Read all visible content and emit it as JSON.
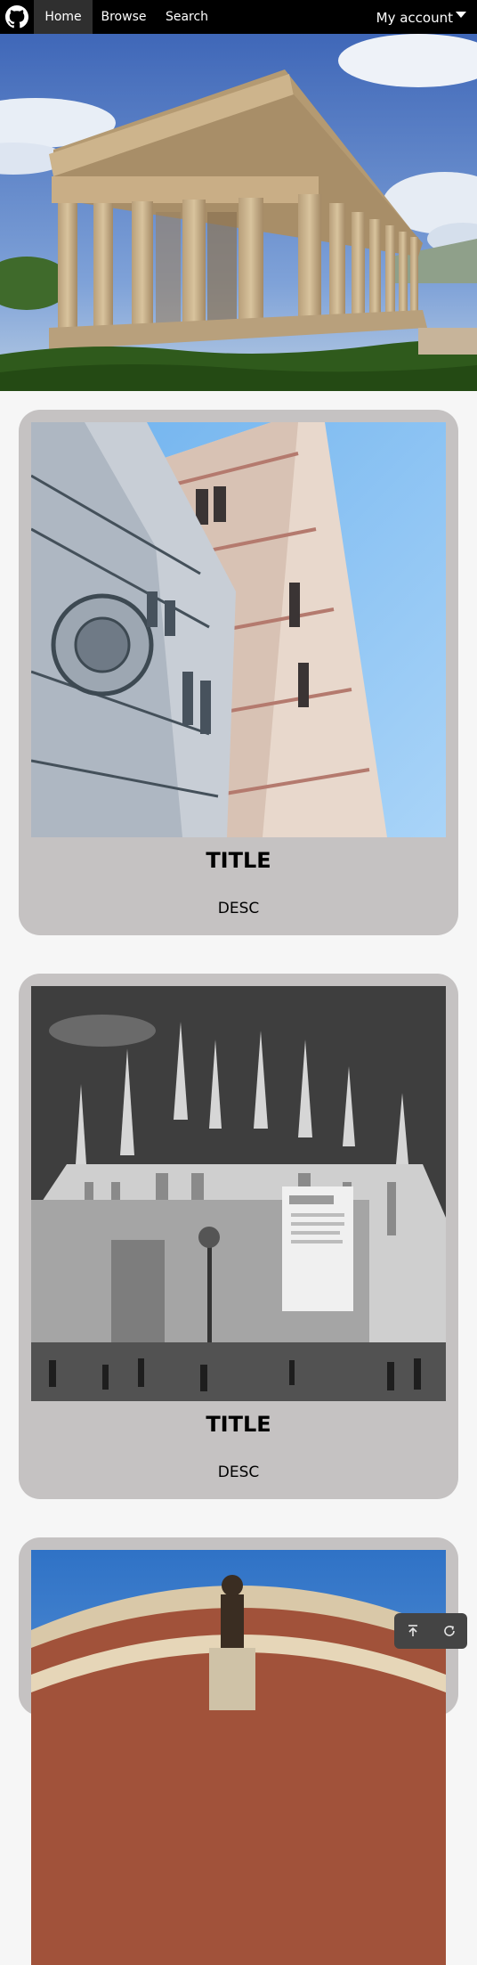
{
  "navbar": {
    "logo_icon": "github-icon",
    "items": [
      {
        "label": "Home",
        "active": true
      },
      {
        "label": "Browse",
        "active": false
      },
      {
        "label": "Search",
        "active": false
      }
    ],
    "account_label": "My account"
  },
  "hero": {
    "image": "greek-temple-photo"
  },
  "cards": [
    {
      "title": "TITLE",
      "desc": "DESC",
      "image": "florence-cathedral-photo"
    },
    {
      "title": "TITLE",
      "desc": "DESC",
      "image": "milan-cathedral-photo"
    },
    {
      "title": "",
      "desc": "",
      "image": "royal-albert-hall-photo"
    }
  ],
  "controls": {
    "scroll_top_icon": "arrow-up-to-top-icon",
    "refresh_icon": "refresh-icon"
  },
  "colors": {
    "navbar_bg": "#000000",
    "active_tab_bg": "#2f2f2f",
    "card_bg": "#c5c2c2",
    "page_bg": "#f6f6f6"
  }
}
